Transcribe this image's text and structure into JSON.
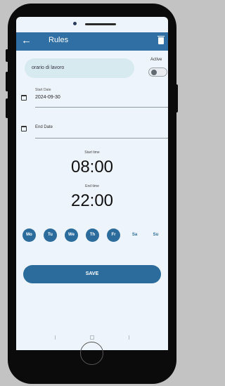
{
  "app": {
    "title": "Rules"
  },
  "rule": {
    "name": "orario di lavoro",
    "active_label": "Active",
    "active": false
  },
  "start_date": {
    "label": "Start Date",
    "value": "2024-09-30"
  },
  "end_date": {
    "label": "End Date"
  },
  "start_time": {
    "label": "Start time",
    "value": "08:00"
  },
  "end_time": {
    "label": "End time",
    "value": "22:00"
  },
  "days": [
    {
      "label": "Mo",
      "selected": true
    },
    {
      "label": "Tu",
      "selected": true
    },
    {
      "label": "We",
      "selected": true
    },
    {
      "label": "Th",
      "selected": true
    },
    {
      "label": "Fr",
      "selected": true
    },
    {
      "label": "Sa",
      "selected": false
    },
    {
      "label": "Su",
      "selected": false
    }
  ],
  "actions": {
    "save_label": "SAVE"
  },
  "colors": {
    "appbar": "#2f6fa3",
    "accent": "#2c6c9d",
    "input_bg": "#d6eaf0",
    "screen_bg": "#eef4fb"
  },
  "icons": [
    "back-arrow-icon",
    "trash-icon",
    "calendar-icon",
    "toggle-switch",
    "nav-back-icon",
    "nav-home-icon",
    "nav-recents-icon"
  ]
}
